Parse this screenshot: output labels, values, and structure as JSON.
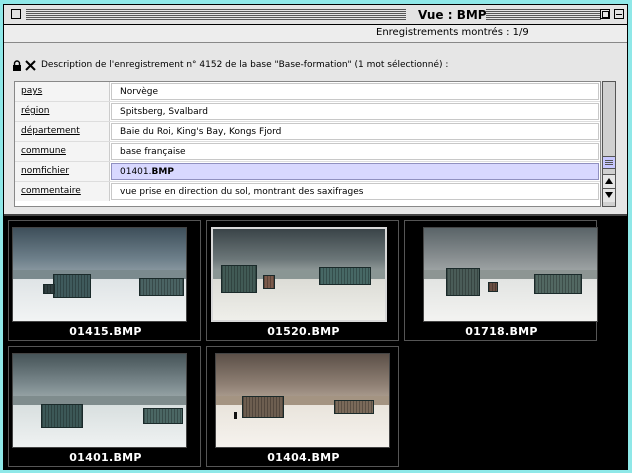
{
  "window": {
    "title": "Vue : BMP"
  },
  "status": {
    "records_shown": "Enregistrements montrés : 1/9"
  },
  "description": {
    "header": "Description de l'enregistrement n° 4152 de la base \"Base-formation\" (1 mot sélectionné) :",
    "fields": [
      {
        "label": "pays",
        "value": "Norvège"
      },
      {
        "label": "région",
        "value": "Spitsberg, Svalbard"
      },
      {
        "label": "département",
        "value": "Baie du Roi, King's Bay, Kongs Fjord"
      },
      {
        "label": "commune",
        "value": "base française"
      },
      {
        "label": "nomfichier",
        "value_prefix": "01401.",
        "value_bold": "BMP"
      },
      {
        "label": "commentaire",
        "value": "vue prise en direction du sol, montrant des saxifrages"
      }
    ]
  },
  "gallery": {
    "items": [
      {
        "caption": "01415.BMP",
        "tint": "color"
      },
      {
        "caption": "01520.BMP",
        "tint": "color",
        "selected": true
      },
      {
        "caption": "01718.BMP",
        "tint": "color"
      },
      {
        "caption": "01401.BMP",
        "tint": "color"
      },
      {
        "caption": "01404.BMP",
        "tint": "sepia"
      }
    ]
  },
  "colors": {
    "desktop": "#8fe8e8",
    "selection": "#d8d8ff",
    "gallery_bg": "#000000"
  }
}
